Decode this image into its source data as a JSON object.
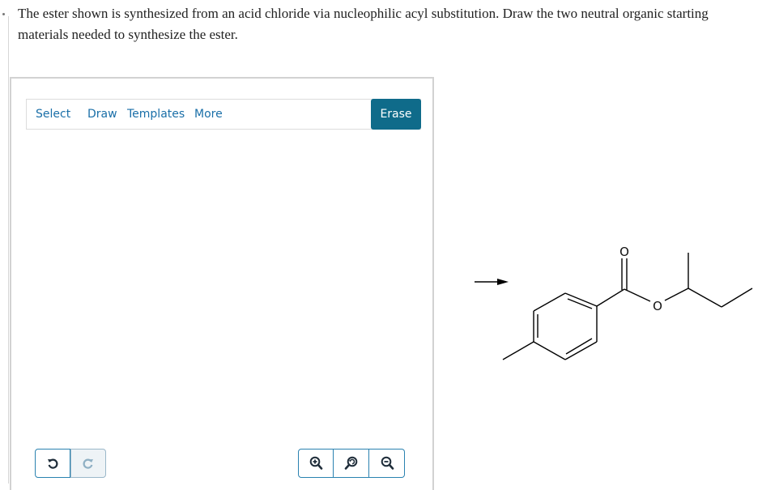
{
  "question": {
    "text": "The ester shown is synthesized from an acid chloride via nucleophilic acyl substitution. Draw the two neutral organic starting materials needed to synthesize the ester."
  },
  "toolbar": {
    "select": "Select",
    "draw": "Draw",
    "templates": "Templates",
    "more": "More",
    "erase": "Erase"
  },
  "controls": {
    "undo_icon": "undo-icon",
    "redo_icon": "redo-icon",
    "zoom_in_icon": "zoom-in-icon",
    "zoom_reset_icon": "zoom-reset-icon",
    "zoom_out_icon": "zoom-out-icon"
  },
  "molecule": {
    "carbonyl_oxygen": "O",
    "ester_oxygen": "O"
  },
  "colors": {
    "accent": "#0f6b8a",
    "link": "#1a6fa8",
    "button_border": "#2a82b0"
  }
}
